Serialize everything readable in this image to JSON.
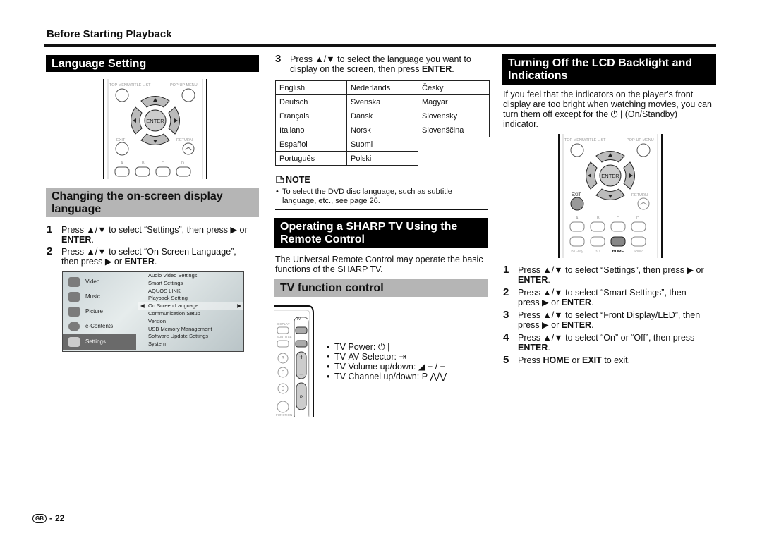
{
  "page": {
    "section_label": "Before Starting Playback",
    "page_number": "22",
    "region_badge": "GB"
  },
  "language_setting": {
    "title": "Language Setting",
    "remote": {
      "top_left": "TOP MENU/TITLE LIST",
      "top_right": "POP-UP MENU",
      "enter": "ENTER",
      "exit": "EXIT",
      "return": "RETURN",
      "color_buttons": [
        "A",
        "B",
        "C",
        "D"
      ]
    }
  },
  "changing_language": {
    "title": "Changing the on-screen display language",
    "steps": [
      {
        "num": "1",
        "pre": "Press ▲/▼ to select “Settings”, then press ▶ or ",
        "bold": "ENTER",
        "post": "."
      },
      {
        "num": "2",
        "pre": "Press ▲/▼ to select “On Screen Language”, then press ▶ or ",
        "bold": "ENTER",
        "post": "."
      }
    ],
    "menu": {
      "left": [
        "Video",
        "Music",
        "Picture",
        "e-Contents",
        "Settings"
      ],
      "left_selected": "Settings",
      "right": [
        "Audio Video Settings",
        "Smart Settings",
        "AQUOS LINK",
        "Playback Setting",
        "On Screen Language",
        "Communication Setup",
        "Version",
        "USB Memory Management",
        "Software Update Settings",
        "System"
      ],
      "right_selected": "On Screen Language"
    }
  },
  "select_language": {
    "step": {
      "num": "3",
      "pre": "Press ▲/▼ to select the language you want to display on the screen, then press ",
      "bold": "ENTER",
      "post": "."
    },
    "table": [
      [
        "English",
        "Nederlands",
        "Česky"
      ],
      [
        "Deutsch",
        "Svenska",
        "Magyar"
      ],
      [
        "Français",
        "Dansk",
        "Slovensky"
      ],
      [
        "Italiano",
        "Norsk",
        "Slovenščina"
      ],
      [
        "Español",
        "Suomi",
        ""
      ],
      [
        "Português",
        "Polski",
        ""
      ]
    ],
    "note_title": "NOTE",
    "note_text": "To select the DVD disc language, such as subtitle language, etc., see page 26."
  },
  "sharp_tv": {
    "title": "Operating a SHARP TV Using the Remote Control",
    "intro": "The Universal Remote Control may operate the basic functions of the SHARP TV.",
    "tv_function_title": "TV function control",
    "remote": {
      "tv_label": "TV",
      "display": "DISPLAY",
      "subtitle": "SUBTITLE",
      "function": "FUNCTION",
      "numbers": [
        "3",
        "6",
        "9"
      ],
      "vol_plus": "+",
      "vol_minus": "−",
      "ch_p": "P"
    },
    "bullets": [
      "TV Power: ⏻ |",
      "TV-AV Selector: ⇥",
      "TV Volume up/down: ◢ + / −",
      "TV Channel up/down: P ⋀/⋁"
    ]
  },
  "lcd_backlight": {
    "title": "Turning Off the LCD Backlight and Indications",
    "intro": "If you feel that the indicators on the player's front display are too bright when watching movies, you can turn them off except for the ⏻ | (On/Standby) indicator.",
    "remote": {
      "top_left": "TOP MENU/TITLE LIST",
      "top_right": "POP-UP MENU",
      "enter": "ENTER",
      "exit": "EXIT",
      "return": "RETURN",
      "color_buttons": [
        "A",
        "B",
        "C",
        "D"
      ],
      "bottom_buttons": [
        "Blu-ray",
        "3D",
        "HOME",
        "PinP"
      ]
    },
    "steps": [
      {
        "num": "1",
        "pre": "Press ▲/▼ to select “Settings”, then press ▶ or ",
        "bold": "ENTER",
        "post": "."
      },
      {
        "num": "2",
        "pre": "Press ▲/▼ to select “Smart Settings”, then press ▶ or ",
        "bold": "ENTER",
        "post": "."
      },
      {
        "num": "3",
        "pre": "Press ▲/▼ to select “Front Display/LED”, then press ▶ or ",
        "bold": "ENTER",
        "post": "."
      },
      {
        "num": "4",
        "pre": "Press ▲/▼ to select “On” or “Off”, then press ",
        "bold": "ENTER",
        "post": "."
      },
      {
        "num": "5",
        "pre": "Press ",
        "bold": "HOME",
        "mid": " or ",
        "bold2": "EXIT",
        "post": " to exit."
      }
    ]
  }
}
